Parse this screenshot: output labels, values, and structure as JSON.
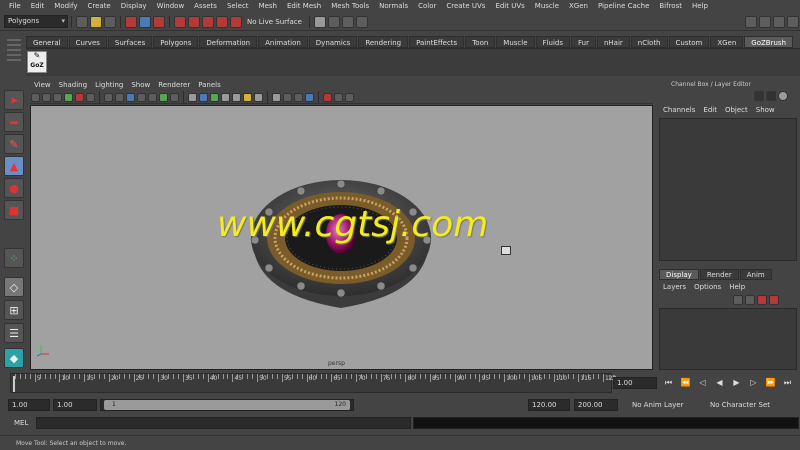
{
  "menubar": [
    "File",
    "Edit",
    "Modify",
    "Create",
    "Display",
    "Window",
    "Assets",
    "Select",
    "Mesh",
    "Edit Mesh",
    "Mesh Tools",
    "Normals",
    "Color",
    "Create UVs",
    "Edit UVs",
    "Muscle",
    "XGen",
    "Pipeline Cache",
    "Bifrost",
    "Help"
  ],
  "status": {
    "menu_set": "Polygons",
    "live_surface": "No Live Surface"
  },
  "shelf": {
    "tabs": [
      "General",
      "Curves",
      "Surfaces",
      "Polygons",
      "Deformation",
      "Animation",
      "Dynamics",
      "Rendering",
      "PaintEffects",
      "Toon",
      "Muscle",
      "Fluids",
      "Fur",
      "nHair",
      "nCloth",
      "Custom",
      "XGen",
      "GoZBrush"
    ],
    "active_tab": "GoZBrush",
    "goz_label": "GoZ"
  },
  "viewport": {
    "menu": [
      "View",
      "Shading",
      "Lighting",
      "Show",
      "Renderer",
      "Panels"
    ],
    "camera": "persp"
  },
  "watermark": "www.cgtsj.com",
  "channel_box": {
    "title": "Channel Box / Layer Editor",
    "menu": [
      "Channels",
      "Edit",
      "Object",
      "Show"
    ]
  },
  "layer_editor": {
    "tabs": [
      "Display",
      "Render",
      "Anim"
    ],
    "active_tab": "Display",
    "menu": [
      "Layers",
      "Options",
      "Help"
    ]
  },
  "timeline": {
    "ticks": [
      5,
      10,
      15,
      20,
      25,
      30,
      35,
      40,
      45,
      50,
      55,
      60,
      65,
      70,
      75,
      80,
      85,
      90,
      95,
      100,
      105,
      110,
      115,
      120
    ],
    "extra_tick": "12",
    "start": 1,
    "end": 120,
    "current_frame": "1.00"
  },
  "range": {
    "start_time": "1.00",
    "playback_start": "1.00",
    "range_start": "1",
    "range_end": "120",
    "playback_end": "120.00",
    "end_time": "200.00",
    "anim_layer": "No Anim Layer",
    "character_set": "No Character Set"
  },
  "command": {
    "label": "MEL"
  },
  "help_line": "Move Tool: Select an object to move.",
  "colors": {
    "viewport_bg": "#a1a1a1",
    "watermark": "#f4ec1c",
    "ui_bg": "#444444"
  }
}
